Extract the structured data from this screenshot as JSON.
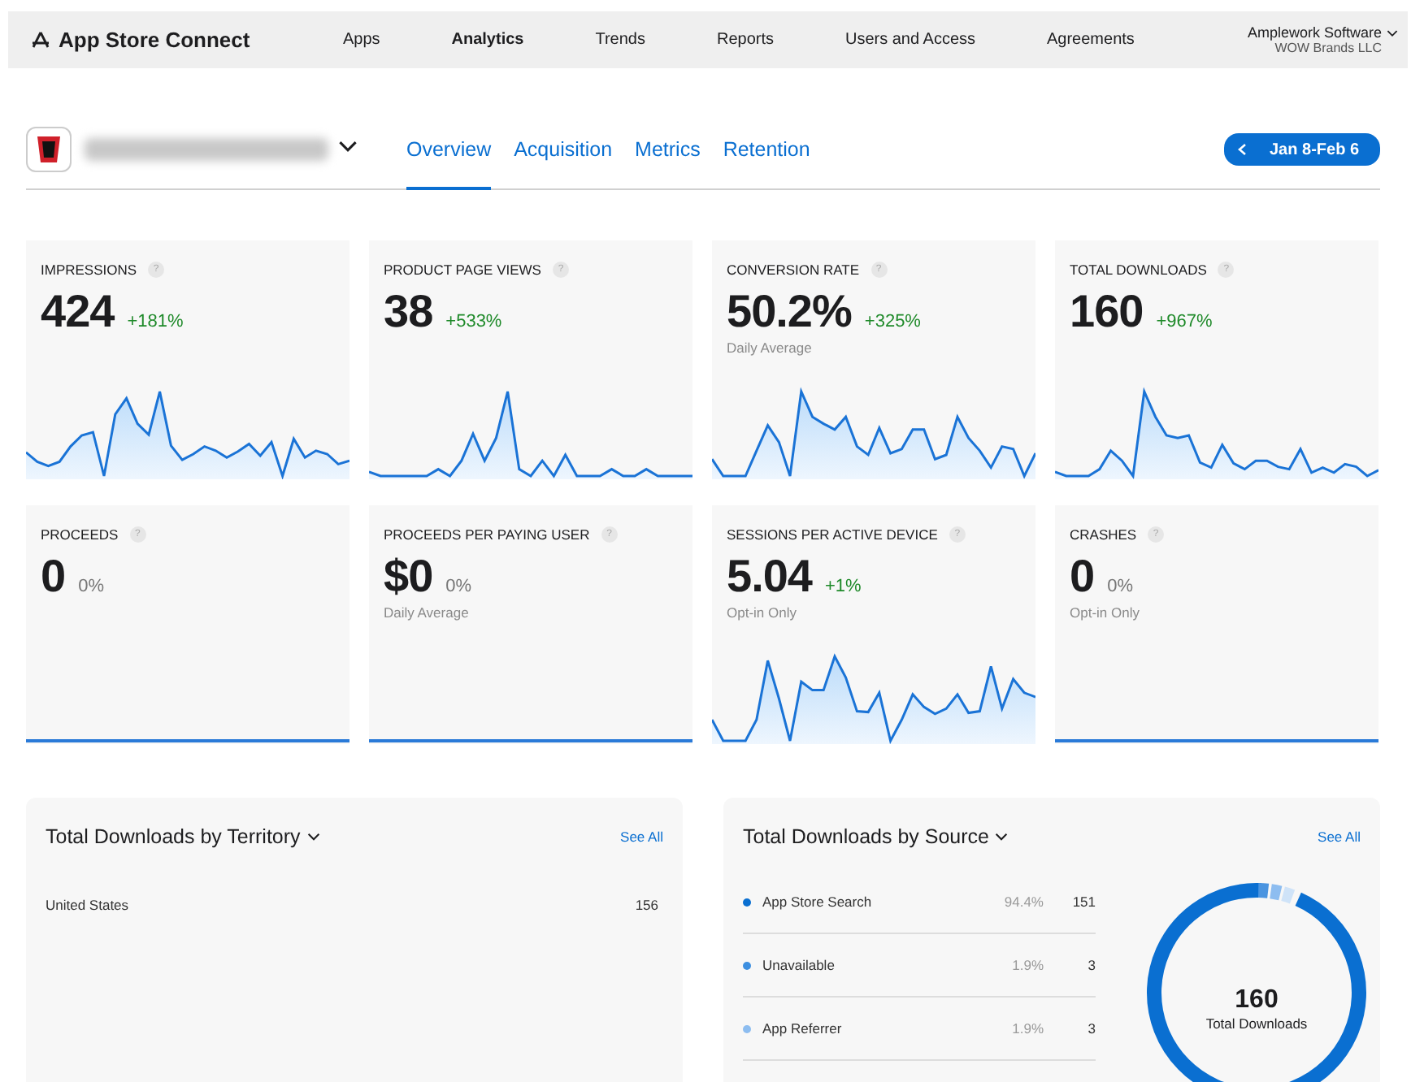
{
  "top_bar": {
    "brand": "App Store Connect",
    "nav": [
      {
        "label": "Apps",
        "selected": false
      },
      {
        "label": "Analytics",
        "selected": true
      },
      {
        "label": "Trends",
        "selected": false
      },
      {
        "label": "Reports",
        "selected": false
      },
      {
        "label": "Users and Access",
        "selected": false
      },
      {
        "label": "Agreements",
        "selected": false
      }
    ],
    "account": {
      "name": "Amplework Software",
      "org": "WOW Brands LLC"
    }
  },
  "header": {
    "tabs": [
      {
        "label": "Overview",
        "selected": true
      },
      {
        "label": "Acquisition",
        "selected": false
      },
      {
        "label": "Metrics",
        "selected": false
      },
      {
        "label": "Retention",
        "selected": false
      }
    ],
    "date_range": "Jan 8-Feb 6"
  },
  "metrics": [
    {
      "title": "IMPRESSIONS",
      "help": "?",
      "value": "424",
      "change": "+181%",
      "positive": true,
      "kind": "spark"
    },
    {
      "title": "PRODUCT PAGE VIEWS",
      "help": "?",
      "value": "38",
      "change": "+533%",
      "positive": true,
      "kind": "spark"
    },
    {
      "title": "CONVERSION RATE",
      "help": "?",
      "value": "50.2%",
      "change": "+325%",
      "positive": true,
      "note": "Daily Average",
      "kind": "spark"
    },
    {
      "title": "TOTAL DOWNLOADS",
      "help": "?",
      "value": "160",
      "change": "+967%",
      "positive": true,
      "kind": "spark"
    },
    {
      "title": "PROCEEDS",
      "help": "?",
      "value": "0",
      "change": "0%",
      "positive": false,
      "kind": "flat"
    },
    {
      "title": "PROCEEDS PER PAYING USER",
      "help": "?",
      "value": "$0",
      "change": "0%",
      "positive": false,
      "note": "Daily Average",
      "kind": "flat"
    },
    {
      "title": "SESSIONS PER ACTIVE DEVICE",
      "help": "?",
      "value": "5.04",
      "change": "+1%",
      "positive": true,
      "note": "Opt-in Only",
      "kind": "spark"
    },
    {
      "title": "CRASHES",
      "help": "?",
      "value": "0",
      "change": "0%",
      "positive": false,
      "note": "Opt-in Only",
      "kind": "flat"
    }
  ],
  "territory": {
    "title": "Total Downloads by Territory",
    "see_all": "See All",
    "rows": [
      {
        "name": "United States",
        "count": "156"
      }
    ]
  },
  "source": {
    "title": "Total Downloads by Source",
    "see_all": "See All",
    "rows": [
      {
        "name": "App Store Search",
        "share": "94.4%",
        "count": "151",
        "color": "#0a6fd1"
      },
      {
        "name": "Unavailable",
        "share": "1.9%",
        "count": "3",
        "color": "#3d8fe0"
      },
      {
        "name": "App Referrer",
        "share": "1.9%",
        "count": "3",
        "color": "#8dbdf0"
      }
    ],
    "total": "160",
    "total_label": "Total Downloads"
  }
}
